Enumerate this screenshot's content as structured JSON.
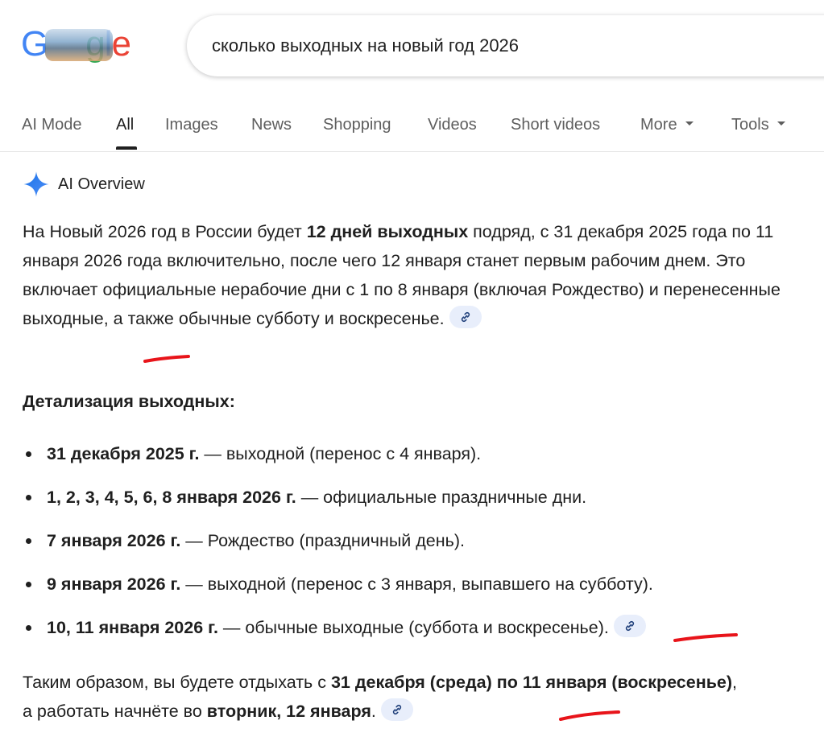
{
  "search": {
    "query": "сколько выходных на новый год 2026"
  },
  "tabs": [
    {
      "label": "AI Mode"
    },
    {
      "label": "All"
    },
    {
      "label": "Images"
    },
    {
      "label": "News"
    },
    {
      "label": "Shopping"
    },
    {
      "label": "Videos"
    },
    {
      "label": "Short videos"
    },
    {
      "label": "More"
    },
    {
      "label": "Tools"
    }
  ],
  "ai_overview": {
    "label": "AI Overview",
    "intro": {
      "p1": "На Новый 2026 год в России будет ",
      "bold1": "12 дней выходных",
      "p2": " подряд, с 31 декабря 2025 года по 11 января 2026 года включительно, после чего 12 января станет первым рабочим днем. Это включает официальные нерабочие дни с 1 по 8 января (включая Рождество) и перенесенные выходные, а также обычные субботу и воскресенье."
    },
    "details_title": "Детализация выходных:",
    "items": [
      {
        "bold": "31 декабря 2025 г.",
        "text": " — выходной (перенос с 4 января)."
      },
      {
        "bold": "1, 2, 3, 4, 5, 6, 8 января 2026 г.",
        "text": " — официальные праздничные дни."
      },
      {
        "bold": "7 января 2026 г.",
        "text": " — Рождество (праздничный день)."
      },
      {
        "bold": "9 января 2026 г.",
        "text": " — выходной (перенос с 3 января, выпавшего на субботу)."
      },
      {
        "bold": "10, 11 января 2026 г.",
        "text": " — обычные выходные (суббота и воскресенье)."
      }
    ],
    "summary": {
      "p1": "Таким образом, вы будете отдыхать с ",
      "bold1": "31 декабря (среда) по 11 января (воскресенье)",
      "p2": ", а работать начнёте во ",
      "bold2": "вторник, 12 января",
      "p3": "."
    }
  },
  "colors": {
    "accent": "#4285f4",
    "annotation": "#e8141a",
    "cite_bg": "#e8eefb"
  }
}
